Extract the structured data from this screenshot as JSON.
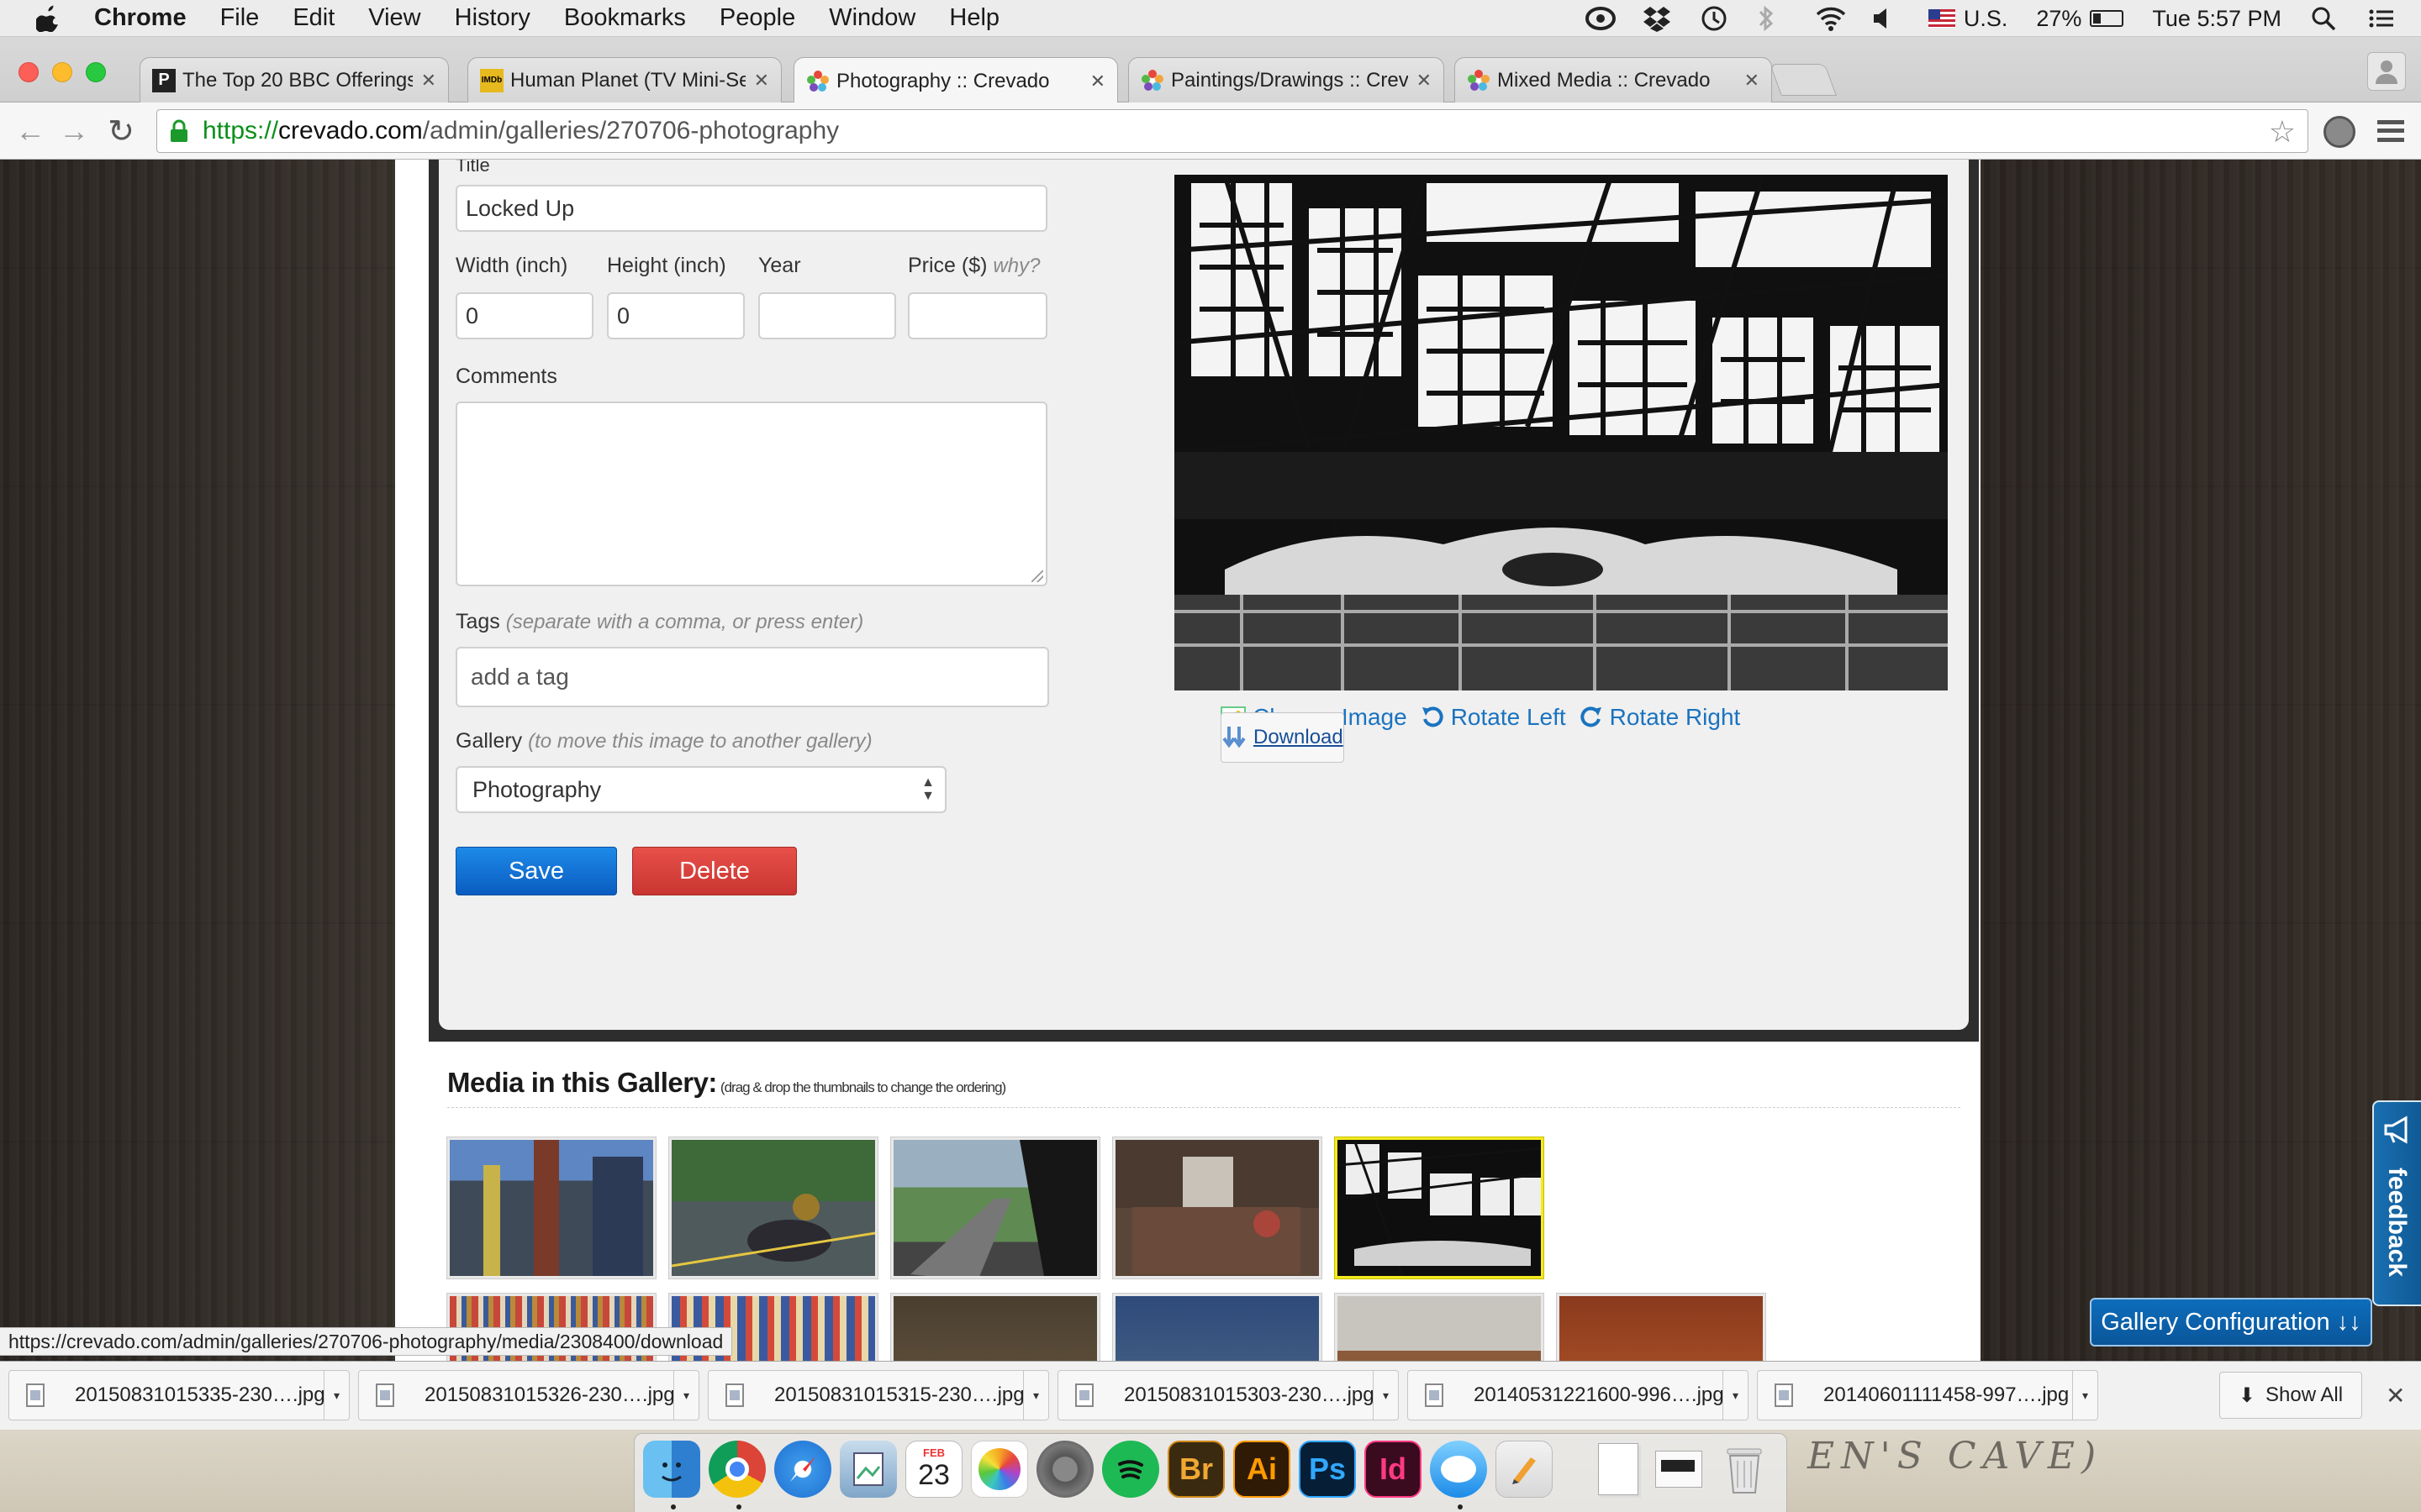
{
  "menubar": {
    "app": "Chrome",
    "items": [
      "File",
      "Edit",
      "View",
      "History",
      "Bookmarks",
      "People",
      "Window",
      "Help"
    ],
    "right": {
      "input_source": "U.S.",
      "battery": "27%",
      "clock": "Tue 5:57 PM"
    }
  },
  "tabs": [
    {
      "title": "The Top 20 BBC Offerings a",
      "favicon": "P"
    },
    {
      "title": "Human Planet (TV Mini-Ser",
      "favicon": "IMDb"
    },
    {
      "title": "Photography :: Crevado",
      "favicon": "crevado"
    },
    {
      "title": "Paintings/Drawings :: Crev",
      "favicon": "crevado"
    },
    {
      "title": "Mixed Media :: Crevado",
      "favicon": "crevado"
    }
  ],
  "address": {
    "protocol": "https://",
    "host": "crevado.com",
    "path": "/admin/galleries/270706-photography"
  },
  "form": {
    "title_label": "Title",
    "title_value": "Locked Up",
    "width_label": "Width (inch)",
    "width_value": "0",
    "height_label": "Height (inch)",
    "height_value": "0",
    "year_label": "Year",
    "year_value": "",
    "price_label": "Price ($)",
    "price_hint": "why?",
    "price_value": "",
    "comments_label": "Comments",
    "tags_label": "Tags",
    "tags_hint": "(separate with a comma, or press enter)",
    "tags_placeholder": "add a tag",
    "gallery_label": "Gallery",
    "gallery_hint": "(to move this image to another gallery)",
    "gallery_selected": "Photography",
    "save_label": "Save",
    "delete_label": "Delete"
  },
  "image_actions": {
    "change": "Change Image",
    "rotate_left": "Rotate Left",
    "rotate_right": "Rotate Right",
    "download": "Download"
  },
  "media": {
    "title": "Media in this Gallery:",
    "hint": "(drag & drop the thumbnails to change the ordering)"
  },
  "status_url": "https://crevado.com/admin/galleries/270706-photography/media/2308400/download",
  "feedback_label": "feedback",
  "gallery_config_label": "Gallery Configuration ↓↓",
  "downloads": [
    "20150831015335-230….jpg",
    "20150831015326-230….jpg",
    "20150831015315-230….jpg",
    "20150831015303-230….jpg",
    "20140531221600-996….jpg",
    "20140601111458-997….jpg"
  ],
  "show_all": "Show All",
  "dock": {
    "calendar_month": "FEB",
    "calendar_day": "23",
    "apps": [
      "Finder",
      "Chrome",
      "Safari",
      "Preview",
      "Calendar",
      "Photos",
      "System Preferences",
      "Spotify",
      "Br",
      "Ai",
      "Ps",
      "Id",
      "Messages",
      "Pages",
      "Document",
      "Trash"
    ]
  },
  "desktop_text": "EN'S  CAVE)",
  "colors": {
    "link": "#1a73c0",
    "save": "#0f6fd6",
    "delete": "#d8413c",
    "selected_thumb": "#f3ea1e",
    "feedback": "#1565a8"
  }
}
